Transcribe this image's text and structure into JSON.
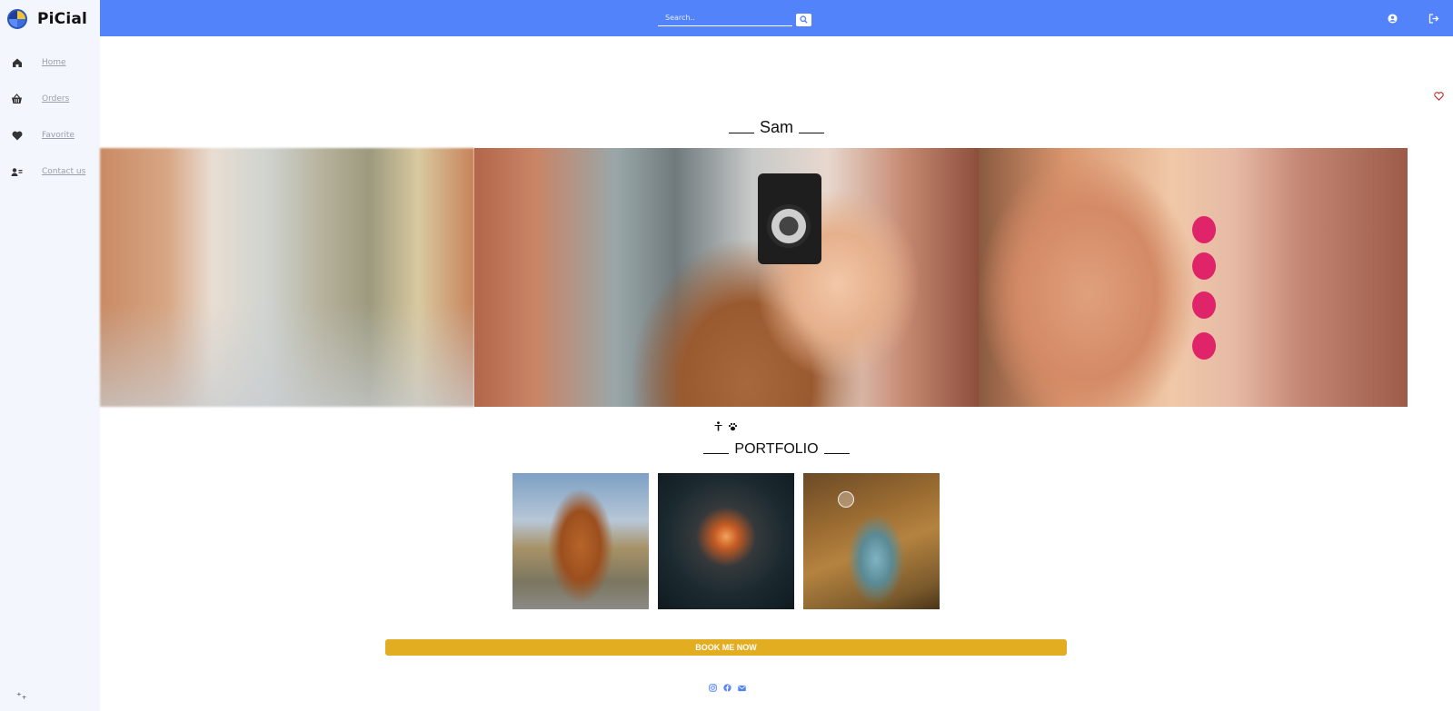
{
  "brand": {
    "name": "PiCial"
  },
  "sidebar": {
    "items": [
      {
        "label": "Home",
        "icon": "home-icon"
      },
      {
        "label": "Orders",
        "icon": "basket-icon"
      },
      {
        "label": "Favorite",
        "icon": "heart-icon"
      },
      {
        "label": "Contact us",
        "icon": "contact-card-icon"
      }
    ]
  },
  "topbar": {
    "search_placeholder": "Search..",
    "color": "#5283fb"
  },
  "profile": {
    "name": "Sam",
    "portfolio_title": "PORTFOLIO",
    "book_button": "BOOK ME NOW",
    "book_button_color": "#e3ad22"
  },
  "icons": {
    "favorite": "heart-outline-icon",
    "specialties": [
      "person-icon",
      "paw-icon"
    ],
    "social": [
      "instagram-icon",
      "facebook-icon",
      "email-icon"
    ]
  }
}
